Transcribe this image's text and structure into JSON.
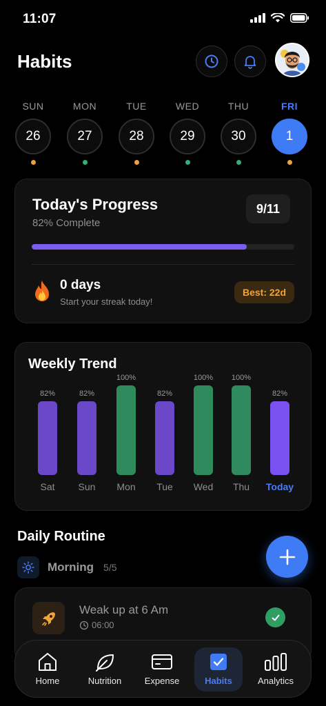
{
  "status_bar": {
    "time": "11:07"
  },
  "header": {
    "title": "Habits"
  },
  "days": [
    {
      "name": "SUN",
      "date": "26",
      "dot_color": "#f0a23a",
      "selected": false
    },
    {
      "name": "MON",
      "date": "27",
      "dot_color": "#33b07a",
      "selected": false
    },
    {
      "name": "TUE",
      "date": "28",
      "dot_color": "#f0a23a",
      "selected": false
    },
    {
      "name": "WED",
      "date": "29",
      "dot_color": "#33b07a",
      "selected": false
    },
    {
      "name": "THU",
      "date": "30",
      "dot_color": "#33b07a",
      "selected": false
    },
    {
      "name": "FRI",
      "date": "1",
      "dot_color": "#f0a23a",
      "selected": true
    }
  ],
  "progress": {
    "title": "Today's Progress",
    "subtitle": "82% Complete",
    "count": "9/11",
    "fraction": 0.82
  },
  "streak": {
    "title": "0 days",
    "subtitle": "Start your streak today!",
    "best": "Best: 22d",
    "icon": "fire-icon"
  },
  "trend": {
    "title": "Weekly Trend"
  },
  "chart_data": {
    "type": "bar",
    "title": "Weekly Trend",
    "categories": [
      "Sat",
      "Sun",
      "Mon",
      "Tue",
      "Wed",
      "Thu",
      "Today"
    ],
    "values": [
      82,
      82,
      100,
      82,
      100,
      100,
      82
    ],
    "value_labels": [
      "82%",
      "82%",
      "100%",
      "82%",
      "100%",
      "100%",
      "82%"
    ],
    "ylim": [
      0,
      100
    ],
    "grid": false,
    "legend": "none",
    "colors": [
      "#6b48c8",
      "#6b48c8",
      "#2f8b5e",
      "#6b48c8",
      "#2f8b5e",
      "#2f8b5e",
      "#7b52f2"
    ],
    "highlight_category": "Today"
  },
  "routine": {
    "title": "Daily Routine",
    "section_name": "Morning",
    "section_count": "5/5",
    "habits": [
      {
        "title": "Weak up at 6 Am",
        "time": "06:00",
        "icon": "rocket-icon",
        "done": true
      }
    ]
  },
  "nav": {
    "items": [
      {
        "label": "Home",
        "icon": "home-icon",
        "active": false
      },
      {
        "label": "Nutrition",
        "icon": "leaf-icon",
        "active": false
      },
      {
        "label": "Expense",
        "icon": "card-icon",
        "active": false
      },
      {
        "label": "Habits",
        "icon": "checkbox-icon",
        "active": true
      },
      {
        "label": "Analytics",
        "icon": "bar-chart-icon",
        "active": false
      }
    ]
  },
  "colors": {
    "accent": "#3f7bf4",
    "purple": "#7b5cf0",
    "green": "#2f8b5e",
    "orange": "#f0a23a"
  }
}
